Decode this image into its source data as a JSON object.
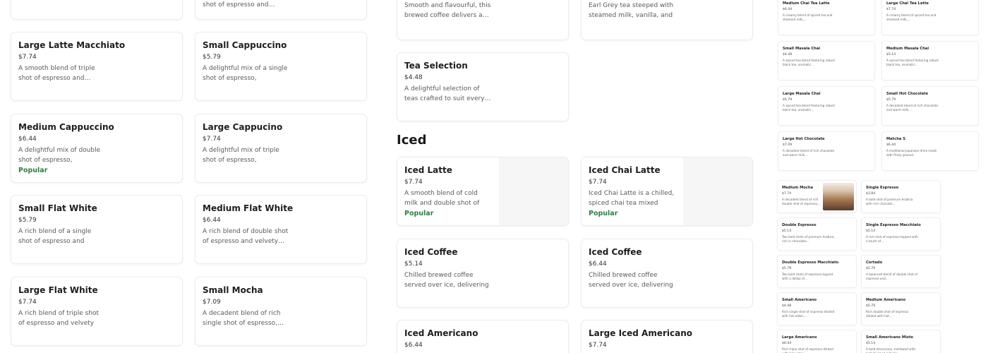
{
  "col1": [
    {
      "title": "",
      "price": "",
      "desc": "",
      "badge": ""
    },
    {
      "title": "Large Latte Macchiato",
      "price": "$7.74",
      "desc": "A smooth blend of triple shot of espresso and…",
      "badge": ""
    },
    {
      "title": "Medium Cappuccino",
      "price": "$6.44",
      "desc": "A delightful mix of double shot of espresso, steamed…",
      "badge": "Popular"
    },
    {
      "title": "Small Flat White",
      "price": "$5.79",
      "desc": "A rich blend of a single shot of espresso and velvety…",
      "badge": ""
    },
    {
      "title": "Large Flat White",
      "price": "$7.74",
      "desc": "A rich blend of triple shot of espresso and velvety micr…",
      "badge": ""
    }
  ],
  "col2": [
    {
      "title": "",
      "price": "",
      "desc": "shot of espresso and…",
      "badge": ""
    },
    {
      "title": "Small Cappuccino",
      "price": "$5.79",
      "desc": "A delightful mix of a single shot of espresso, steamed…",
      "badge": ""
    },
    {
      "title": "Large Cappucino",
      "price": "$7.74",
      "desc": "A delightful mix of triple shot of espresso, steamed…",
      "badge": ""
    },
    {
      "title": "Medium Flat White",
      "price": "$6.44",
      "desc": "A rich blend of double shot of espresso and velvety…",
      "badge": ""
    },
    {
      "title": "Small Mocha",
      "price": "$7.09",
      "desc": "A decadent blend of rich single shot of espresso,…",
      "badge": ""
    }
  ],
  "hot_top": [
    {
      "title": "",
      "price": "",
      "desc": "Smooth and flavourful, this brewed coffee delivers a…"
    },
    {
      "title": "",
      "price": "",
      "desc": "Earl Grey tea steeped with steamed milk, vanilla, and …"
    }
  ],
  "tea": {
    "title": "Tea Selection",
    "price": "$4.48",
    "desc": "A delightful selection of teas crafted to suit every…"
  },
  "iced_section": "Iced",
  "iced": [
    {
      "title": "Iced Latte",
      "price": "$7.74",
      "desc": "A smooth blend of cold milk and double shot of espress…",
      "badge": "Popular"
    },
    {
      "title": "Iced Chai Latte",
      "price": "$7.74",
      "desc": "Iced Chai Latte is a chilled, spiced chai tea mixed with…",
      "badge": "Popular"
    },
    {
      "title": "Iced Coffee",
      "price": "$5.14",
      "desc": "Chilled brewed coffee served over ice, delivering …",
      "badge": ""
    },
    {
      "title": "Iced Coffee",
      "price": "$6.44",
      "desc": "Chilled brewed coffee served over ice, delivering …",
      "badge": ""
    },
    {
      "title": "Iced Americano",
      "price": "$6.44",
      "desc": "",
      "badge": ""
    },
    {
      "title": "Large Iced Americano",
      "price": "$7.74",
      "desc": "",
      "badge": ""
    }
  ],
  "mini_top": [
    {
      "title": "Medium Chai Tea Latte",
      "price": "$6.44",
      "desc": "A creamy blend of spiced tea and steamed milk,…"
    },
    {
      "title": "Large Chai Tea Latte",
      "price": "$7.74",
      "desc": "A creamy blend of spiced tea and steamed milk,…"
    },
    {
      "title": "Small Masala Chai",
      "price": "$4.48",
      "desc": "A spiced tea blend featuring robust black tea, aromatic…"
    },
    {
      "title": "Medium Masala Chai",
      "price": "$5.14",
      "desc": "A spiced tea blend featuring robust black tea, aromatic…"
    },
    {
      "title": "Large Masala Chai",
      "price": "$5.79",
      "desc": "A spiced tea blend featuring robust black tea, aromatic…"
    },
    {
      "title": "Small Hot Chocolate",
      "price": "$5.79",
      "desc": "A decadent blend of rich chocolate and warm milk,…"
    },
    {
      "title": "Large Hot Chocolate",
      "price": "$7.09",
      "desc": "A decadent blend of rich chocolate and warm milk,…"
    },
    {
      "title": "Matcha S",
      "price": "$6.44",
      "desc": "A traditional Japanese drink made with finely ground…"
    }
  ],
  "mini_bottom": [
    {
      "title": "Medium Mocha",
      "price": "$7.74",
      "desc": "A decadent blend of rich double shot of espresso,…"
    },
    {
      "title": "Single Espresso",
      "price": "$3.84",
      "desc": "A bold shot of premium Arabica with rich chocolat…"
    },
    {
      "title": "Double Espresso",
      "price": "$5.14",
      "desc": "Two bold shots of premium Arabica, rich in chocolate…"
    },
    {
      "title": "Single Espresso Macchiato",
      "price": "$5.14",
      "desc": "A rich shot of espresso topped with a touch of…"
    },
    {
      "title": "Double Espresso Macchiato",
      "price": "$5.79",
      "desc": "Two bold shots of espresso topped with a dollop of…"
    },
    {
      "title": "Cortado",
      "price": "$5.79",
      "desc": "A balanced blend of double shot of espresso and…"
    },
    {
      "title": "Small Americano",
      "price": "$4.48",
      "desc": "Rich single shot of espresso diluted with hot water,…"
    },
    {
      "title": "Medium Americano",
      "price": "$5.79",
      "desc": "Rich double shot of espresso diluted with hot…"
    },
    {
      "title": "Large Americano",
      "price": "$6.44",
      "desc": "Rich triple shot of espresso diluted with hot water,…"
    },
    {
      "title": "Small Americano Misto",
      "price": "$5.14",
      "desc": "A bold Americano, mellowed with half steamed milk for…"
    }
  ]
}
